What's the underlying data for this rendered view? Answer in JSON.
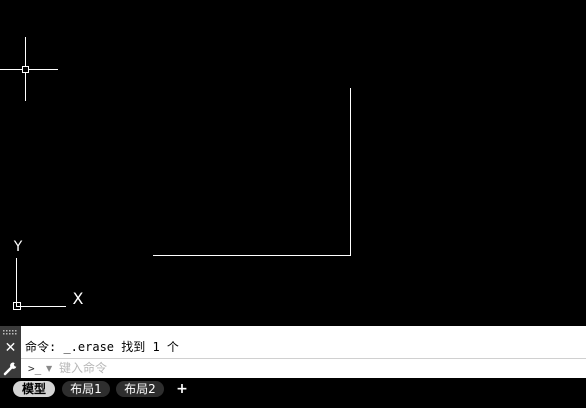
{
  "command_line": {
    "history": "命令: _.erase 找到 1 个",
    "prompt_symbol": ">_",
    "placeholder": "键入命令",
    "input_value": ""
  },
  "ucs_icon": {
    "x_label": "X",
    "y_label": "Y"
  },
  "layout_tabs": {
    "items": [
      {
        "label": "模型",
        "active": true
      },
      {
        "label": "布局1",
        "active": false
      },
      {
        "label": "布局2",
        "active": false
      }
    ],
    "add_label": "+"
  },
  "icons": {
    "close": "close-icon",
    "customize": "wrench-icon",
    "grip": "grip-icon",
    "prompt_dropdown": "chevron-down-icon"
  },
  "colors": {
    "canvas_background": "#000000",
    "geometry": "#ffffff",
    "command_background": "#ffffff",
    "active_tab": "#d4d4d4"
  }
}
